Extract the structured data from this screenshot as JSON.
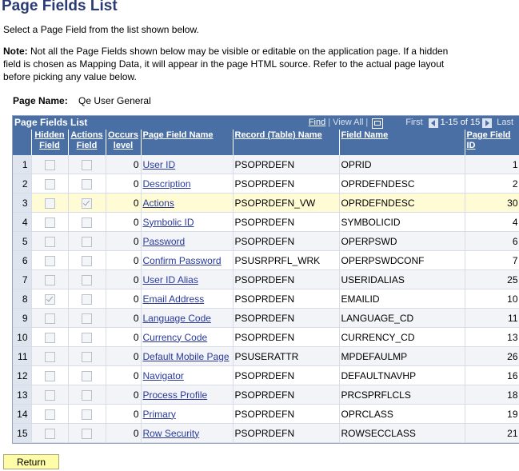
{
  "page": {
    "title": "Page Fields List",
    "instruction": "Select a Page Field from the list shown below.",
    "note_label": "Note:",
    "note_text": " Not all the Page Fields shown below may be visible or editable on the application page. If a hidden field is chosen as Mapping Data, it will appear in the page HTML source. Refer to the actual page layout before picking any value below.",
    "page_name_label": "Page Name:",
    "page_name_value": "Qe User General"
  },
  "grid": {
    "title": "Page Fields List",
    "find_label": "Find",
    "separator": "|",
    "view_all_label": "View All",
    "first_label": "First",
    "range_label": "1-15 of 15",
    "last_label": "Last",
    "icons": {
      "download": "download-grid-icon",
      "prev": "previous-arrow-icon",
      "next": "next-arrow-icon"
    },
    "columns": {
      "hidden": "Hidden Field",
      "actions": "Actions Field",
      "occurs": "Occurs level",
      "page_field_name": "Page Field Name",
      "record": "Record (Table) Name",
      "field_name": "Field Name",
      "page_field_id": "Page Field ID"
    },
    "rows": [
      {
        "num": "1",
        "hidden": false,
        "actions": false,
        "occurs": "0",
        "name": "User ID",
        "record": "PSOPRDEFN",
        "field": "OPRID",
        "id": "1"
      },
      {
        "num": "2",
        "hidden": false,
        "actions": false,
        "occurs": "0",
        "name": "Description",
        "record": "PSOPRDEFN",
        "field": "OPRDEFNDESC",
        "id": "2"
      },
      {
        "num": "3",
        "hidden": false,
        "actions": true,
        "occurs": "0",
        "name": "Actions",
        "record": "PSOPRDEFN_VW",
        "field": "OPRDEFNDESC",
        "id": "30"
      },
      {
        "num": "4",
        "hidden": false,
        "actions": false,
        "occurs": "0",
        "name": "Symbolic ID",
        "record": "PSOPRDEFN",
        "field": "SYMBOLICID",
        "id": "4"
      },
      {
        "num": "5",
        "hidden": false,
        "actions": false,
        "occurs": "0",
        "name": "Password",
        "record": "PSOPRDEFN",
        "field": "OPERPSWD",
        "id": "6"
      },
      {
        "num": "6",
        "hidden": false,
        "actions": false,
        "occurs": "0",
        "name": "Confirm Password",
        "record": "PSUSRPRFL_WRK",
        "field": "OPERPSWDCONF",
        "id": "7"
      },
      {
        "num": "7",
        "hidden": false,
        "actions": false,
        "occurs": "0",
        "name": "User ID Alias",
        "record": "PSOPRDEFN",
        "field": "USERIDALIAS",
        "id": "25"
      },
      {
        "num": "8",
        "hidden": true,
        "actions": false,
        "occurs": "0",
        "name": "Email Address",
        "record": "PSOPRDEFN",
        "field": "EMAILID",
        "id": "10"
      },
      {
        "num": "9",
        "hidden": false,
        "actions": false,
        "occurs": "0",
        "name": "Language Code",
        "record": "PSOPRDEFN",
        "field": "LANGUAGE_CD",
        "id": "11"
      },
      {
        "num": "10",
        "hidden": false,
        "actions": false,
        "occurs": "0",
        "name": "Currency Code",
        "record": "PSOPRDEFN",
        "field": "CURRENCY_CD",
        "id": "13"
      },
      {
        "num": "11",
        "hidden": false,
        "actions": false,
        "occurs": "0",
        "name": "Default Mobile Page",
        "record": "PSUSERATTR",
        "field": "MPDEFAULMP",
        "id": "26"
      },
      {
        "num": "12",
        "hidden": false,
        "actions": false,
        "occurs": "0",
        "name": "Navigator",
        "record": "PSOPRDEFN",
        "field": "DEFAULTNAVHP",
        "id": "16"
      },
      {
        "num": "13",
        "hidden": false,
        "actions": false,
        "occurs": "0",
        "name": "Process Profile",
        "record": "PSOPRDEFN",
        "field": "PRCSPRFLCLS",
        "id": "18"
      },
      {
        "num": "14",
        "hidden": false,
        "actions": false,
        "occurs": "0",
        "name": "Primary",
        "record": "PSOPRDEFN",
        "field": "OPRCLASS",
        "id": "19"
      },
      {
        "num": "15",
        "hidden": false,
        "actions": false,
        "occurs": "0",
        "name": "Row Security",
        "record": "PSOPRDEFN",
        "field": "ROWSECCLASS",
        "id": "21"
      }
    ],
    "highlighted_row": 2
  },
  "buttons": {
    "return_label": "Return"
  }
}
